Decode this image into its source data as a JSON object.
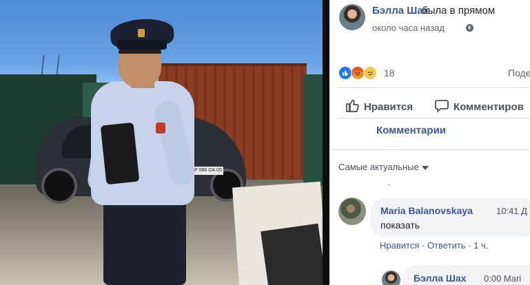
{
  "post": {
    "author": "Бэлла Шах",
    "action": "была в прямом",
    "time": "около часа назад",
    "privacy_icon": "globe-icon"
  },
  "video": {
    "license_plate": "Р 086 ОА 05"
  },
  "reactions": {
    "icons": [
      "like-reaction-icon",
      "angry-reaction-icon",
      "sad-reaction-icon"
    ],
    "count": "18",
    "share_label_partial": "Поде"
  },
  "actions": {
    "like_label": "Нравится",
    "comment_label": "Комментиров"
  },
  "tabs": {
    "comments_label": "Комментарии"
  },
  "comments_section": {
    "sort_label": "Самые актуальные",
    "stray_mark": ".",
    "comments": [
      {
        "author": "Maria Balanovskaya",
        "time": "10:41 Д",
        "text": "показать",
        "like_link": "Нравится",
        "separator": " · ",
        "reply_link": "Ответить",
        "age": "1 ч."
      },
      {
        "author": "Бэлла Шах",
        "time": "0:00 Mari"
      }
    ]
  },
  "colors": {
    "link_blue": "#385898",
    "text_dark": "#1d2129",
    "text_gray": "#606770",
    "bubble_bg": "#f2f3f5",
    "divider": "#dadde1"
  }
}
